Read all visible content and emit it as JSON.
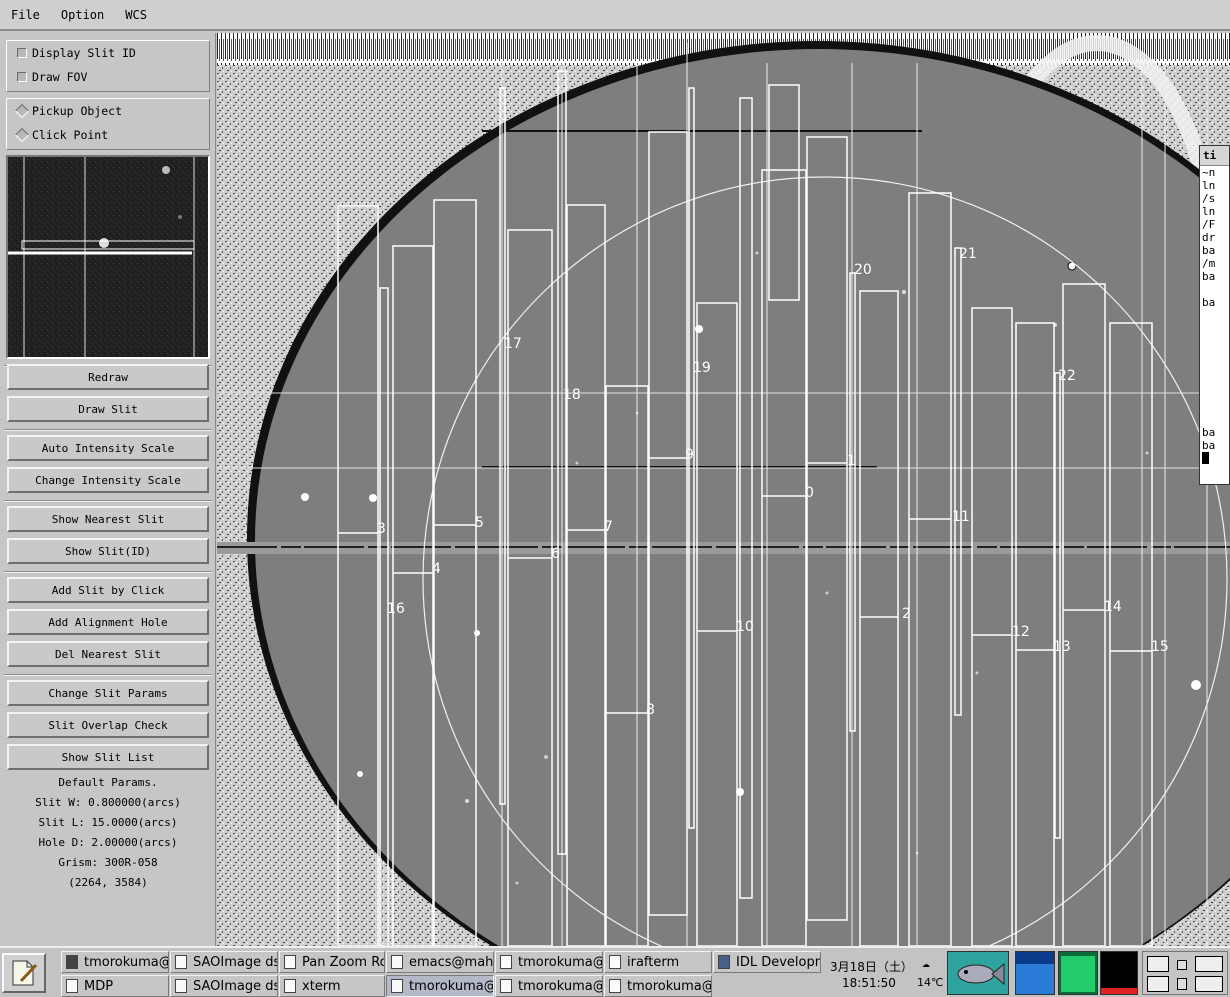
{
  "menu": {
    "file": "File",
    "option": "Option",
    "wcs": "WCS"
  },
  "options": {
    "display_slit_id": "Display Slit ID",
    "draw_fov": "Draw FOV",
    "pickup_object": "Pickup Object",
    "click_point": "Click Point"
  },
  "buttons": {
    "redraw": "Redraw",
    "draw_slit": "Draw Slit",
    "auto_intensity": "Auto Intensity Scale",
    "change_intensity": "Change Intensity Scale",
    "show_nearest": "Show Nearest Slit",
    "show_slit_id": "Show Slit(ID)",
    "add_slit_click": "Add Slit by Click",
    "add_alignment": "Add Alignment Hole",
    "del_nearest": "Del Nearest Slit",
    "change_params": "Change Slit Params",
    "overlap_check": "Slit Overlap Check",
    "show_list": "Show Slit List"
  },
  "params": {
    "title": "Default Params.",
    "slit_w": "Slit W: 0.800000(arcs)",
    "slit_l": "Slit L: 15.0000(arcs)",
    "hole_d": "Hole D: 2.00000(arcs)",
    "grism": "Grism: 300R-058",
    "coords": "(2264, 3584)"
  },
  "slit_labels": [
    "0",
    "1",
    "2",
    "3",
    "4",
    "5",
    "6",
    "7",
    "8",
    "9",
    "10",
    "11",
    "12",
    "13",
    "14",
    "15",
    "16",
    "17",
    "18",
    "19",
    "20",
    "21",
    "22"
  ],
  "sidewin": {
    "title": "ti",
    "lines": [
      "~n",
      "ln",
      "/s",
      "ln",
      "/F",
      "dr",
      "ba",
      "/m",
      "ba",
      "",
      "ba",
      "",
      "",
      "",
      "",
      "",
      "",
      "",
      "",
      "",
      "ba",
      "ba"
    ]
  },
  "taskbar": {
    "row1": [
      "tmorokuma@r",
      "SAOImage ds",
      "Pan Zoom Ro",
      "emacs@mahi",
      "tmorokuma@r",
      "irafterm",
      "IDL Developm"
    ],
    "row2": [
      "MDP",
      "SAOImage ds",
      "xterm",
      "tmorokuma@r",
      "tmorokuma@r",
      "tmorokuma@r"
    ],
    "date": "3月18日（土）",
    "time": "18:51:50",
    "temp": "14℃"
  }
}
